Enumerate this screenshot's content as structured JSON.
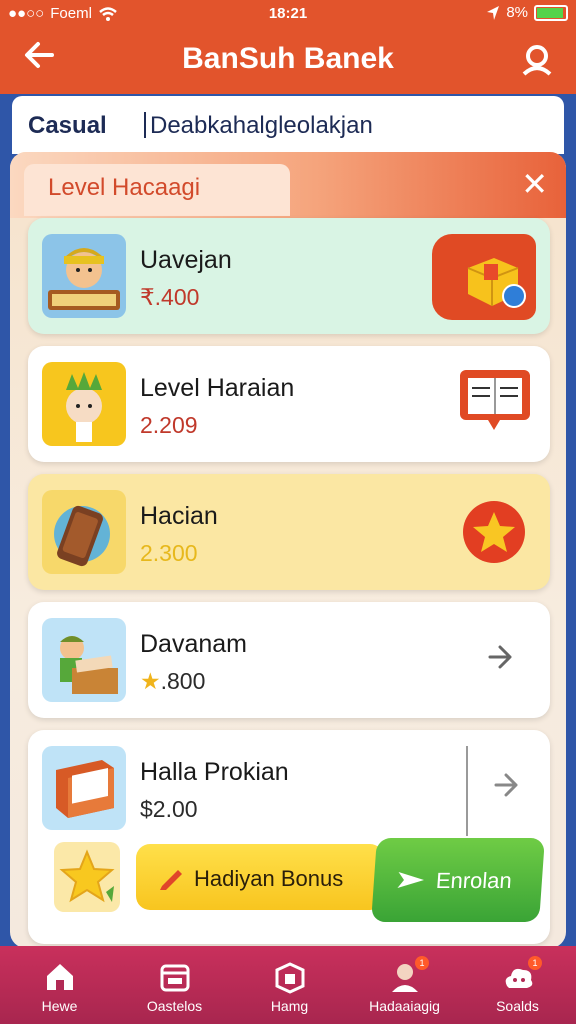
{
  "status_bar": {
    "carrier": "Foeml",
    "time": "18:21",
    "battery": "8%"
  },
  "app_bar": {
    "title": "BanSuh Banek"
  },
  "category": {
    "label": "Casual",
    "subtitle": "Deabkahalgleolakjan"
  },
  "panel": {
    "title": "Level Hacaagi"
  },
  "cards": [
    {
      "name": "Uavejan",
      "price": "₹.400",
      "price_color": "#c0392b",
      "bg": "#d9f4e4",
      "thumb": "boy-with-sign"
    },
    {
      "name": "Level Haraian",
      "price": "2.209",
      "price_color": "#c0392b",
      "bg": "#ffffff",
      "thumb": "face-with-leaves"
    },
    {
      "name": "Hacian",
      "price": "2.300",
      "price_color": "#e7b81c",
      "bg": "#fbe7a3",
      "thumb": "phone"
    },
    {
      "name": "Davanam",
      "price": ".800",
      "price_color": "#2b2b2b",
      "bg": "#ffffff",
      "thumb": "boy-with-box"
    },
    {
      "name": "Halla Prokian",
      "price": "$2.00",
      "price_color": "#2b2b2b",
      "bg": "#ffffff",
      "thumb": "book"
    }
  ],
  "bonus": {
    "label": "Hadiyan Bonus",
    "enroll_label": "Enrolan"
  },
  "tabs": [
    {
      "label": "Hewe",
      "icon": "home-icon"
    },
    {
      "label": "Oastelos",
      "icon": "calendar-icon"
    },
    {
      "label": "Hamg",
      "icon": "box-icon"
    },
    {
      "label": "Hadaaiagig",
      "icon": "user-icon",
      "badge": "1"
    },
    {
      "label": "Soalds",
      "icon": "cloud-icon",
      "badge": "1"
    }
  ],
  "colors": {
    "accent": "#e2542c",
    "tabbar": "#b22a55",
    "background": "#2f56a8"
  }
}
